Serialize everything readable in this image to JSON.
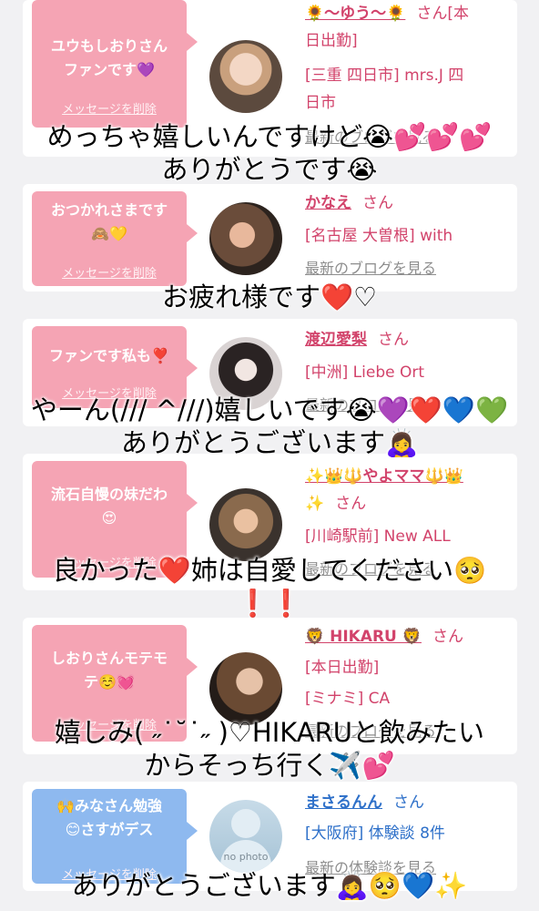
{
  "cards": [
    {
      "bubble_line1": "ユウもしおりさん",
      "bubble_line2": "ファンです💜",
      "delete_label": "メッセージを削除",
      "name_line1": "🌻～ゆう～🌻",
      "san": "さん[本",
      "name_line2": "日出勤]",
      "meta_line1": "[三重 四日市] mrs.J 四",
      "meta_line2": "日市",
      "blog": "最新のブログを見る"
    },
    {
      "bubble_line1": "おつかれさまです",
      "bubble_line2": "🙈💛",
      "delete_label": "メッセージを削除",
      "name": "かなえ",
      "san": "さん",
      "meta_line1": "[名古屋 大曽根] with",
      "blog": "最新のブログを見る"
    },
    {
      "bubble_line1": "ファンです私も❣️",
      "delete_label": "メッセージを削除",
      "name": "渡辺愛梨",
      "san": "さん",
      "meta_line1": "[中洲] Liebe Ort",
      "blog": "最新のブログを見る"
    },
    {
      "bubble_line1": "流石自慢の妹だわ",
      "bubble_line2": "😍",
      "delete_label": "メッセージを削除",
      "name": "✨👑🔱やよママ🔱👑",
      "name_line2": "✨",
      "san": "さん",
      "meta_line1": "[川崎駅前] New ALL",
      "blog": "最新のブログを見る"
    },
    {
      "bubble_line1": "しおりさんモテモ",
      "bubble_line2": "テ☺️💓",
      "delete_label": "メッセージを削除",
      "name": "🦁 HIKARU 🦁",
      "san": "さん",
      "meta_line1": "[本日出勤]",
      "meta_line2": "[ミナミ] CA",
      "blog": "最新のブログを見る"
    },
    {
      "bubble_line1": "🙌みなさん勉強",
      "bubble_line2": "😊さすがデス",
      "delete_label": "メッセージを削除",
      "name": "まさるんん",
      "san": "さん",
      "meta_line1": "[大阪府] 体験談 8件",
      "blog": "最新の体験談を見る",
      "avatar_text": "no photo"
    }
  ],
  "captions": {
    "c1_line1": "めっちゃ嬉しいんですけど😭💕💕💕",
    "c1_line2": "ありがとうです😭",
    "c2": "お疲れ様です❤️♡",
    "c3_line1": "やーん(/// ^///)嬉しいです😭💜❤️💙💚",
    "c3_line2": "ありがとうございます🙇‍♀️",
    "c4_line1": "良かった❤️姉は自愛してください🥺",
    "c4_line2": "❗️❗️",
    "c5_line1": "嬉しみ( ˶˙˘˙˶ )♡HIKARUと飲みたい",
    "c5_line2": "からそっち行く✈️💕",
    "c6": "ありがとうございます🙇‍♀️🥺💙✨"
  },
  "colors": {
    "bubble_pink": "#f5a4b4",
    "bubble_blue": "#8eb9ef",
    "name_pink": "#d2436b",
    "name_blue": "#2e70c9"
  }
}
